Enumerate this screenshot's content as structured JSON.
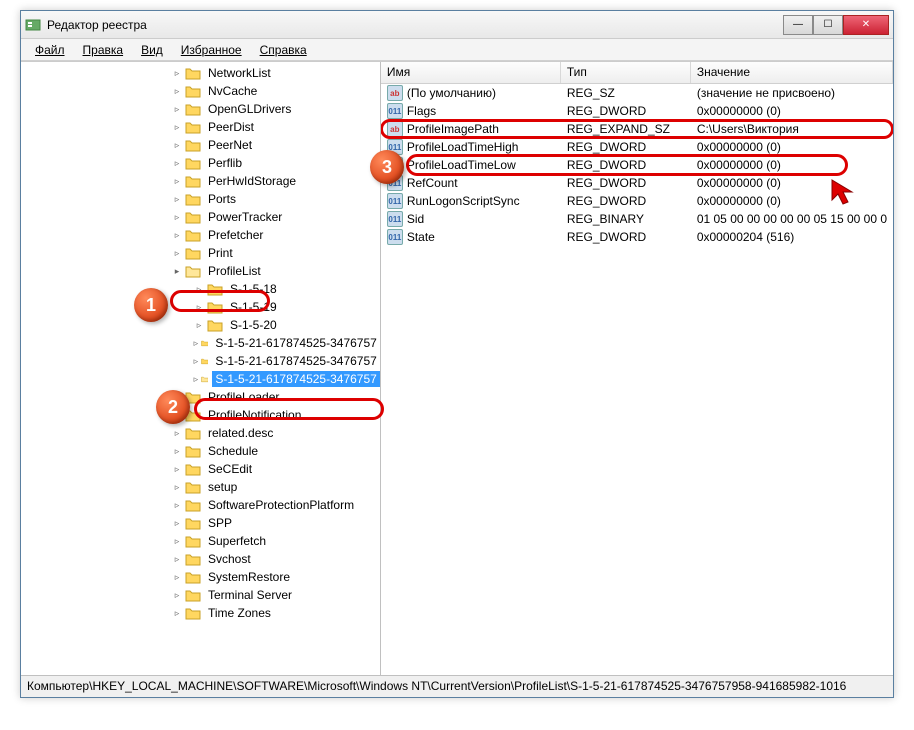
{
  "window": {
    "title": "Редактор реестра"
  },
  "menu": {
    "file": "Файл",
    "edit": "Правка",
    "view": "Вид",
    "favorites": "Избранное",
    "help": "Справка"
  },
  "tree": {
    "items": [
      "NetworkList",
      "NvCache",
      "OpenGLDrivers",
      "PeerDist",
      "PeerNet",
      "Perflib",
      "PerHwIdStorage",
      "Ports",
      "PowerTracker",
      "Prefetcher",
      "Print"
    ],
    "profileList": "ProfileList",
    "sids": [
      "S-1-5-18",
      "S-1-5-19",
      "S-1-5-20",
      "S-1-5-21-617874525-3476757",
      "S-1-5-21-617874525-3476757"
    ],
    "selectedSid": "S-1-5-21-617874525-3476757",
    "items2": [
      "ProfileLoader",
      "ProfileNotification",
      "related.desc",
      "Schedule",
      "SeCEdit",
      "setup",
      "SoftwareProtectionPlatform",
      "SPP",
      "Superfetch",
      "Svchost",
      "SystemRestore",
      "Terminal Server",
      "Time Zones"
    ]
  },
  "list": {
    "cols": {
      "name": "Имя",
      "type": "Тип",
      "value": "Значение"
    },
    "rows": [
      {
        "icon": "str",
        "name": "(По умолчанию)",
        "type": "REG_SZ",
        "value": "(значение не присвоено)"
      },
      {
        "icon": "bin",
        "name": "Flags",
        "type": "REG_DWORD",
        "value": "0x00000000 (0)"
      },
      {
        "icon": "str",
        "name": "ProfileImagePath",
        "type": "REG_EXPAND_SZ",
        "value": "C:\\Users\\Виктория",
        "hl": true
      },
      {
        "icon": "bin",
        "name": "ProfileLoadTimeHigh",
        "type": "REG_DWORD",
        "value": "0x00000000 (0)"
      },
      {
        "icon": "bin",
        "name": "ProfileLoadTimeLow",
        "type": "REG_DWORD",
        "value": "0x00000000 (0)"
      },
      {
        "icon": "bin",
        "name": "RefCount",
        "type": "REG_DWORD",
        "value": "0x00000000 (0)"
      },
      {
        "icon": "bin",
        "name": "RunLogonScriptSync",
        "type": "REG_DWORD",
        "value": "0x00000000 (0)"
      },
      {
        "icon": "bin",
        "name": "Sid",
        "type": "REG_BINARY",
        "value": "01 05 00 00 00 00 00 05 15 00 00 0"
      },
      {
        "icon": "bin",
        "name": "State",
        "type": "REG_DWORD",
        "value": "0x00000204 (516)"
      }
    ]
  },
  "status": "Компьютер\\HKEY_LOCAL_MACHINE\\SOFTWARE\\Microsoft\\Windows NT\\CurrentVersion\\ProfileList\\S-1-5-21-617874525-3476757958-941685982-1016",
  "markers": {
    "m1": "1",
    "m2": "2",
    "m3": "3"
  }
}
